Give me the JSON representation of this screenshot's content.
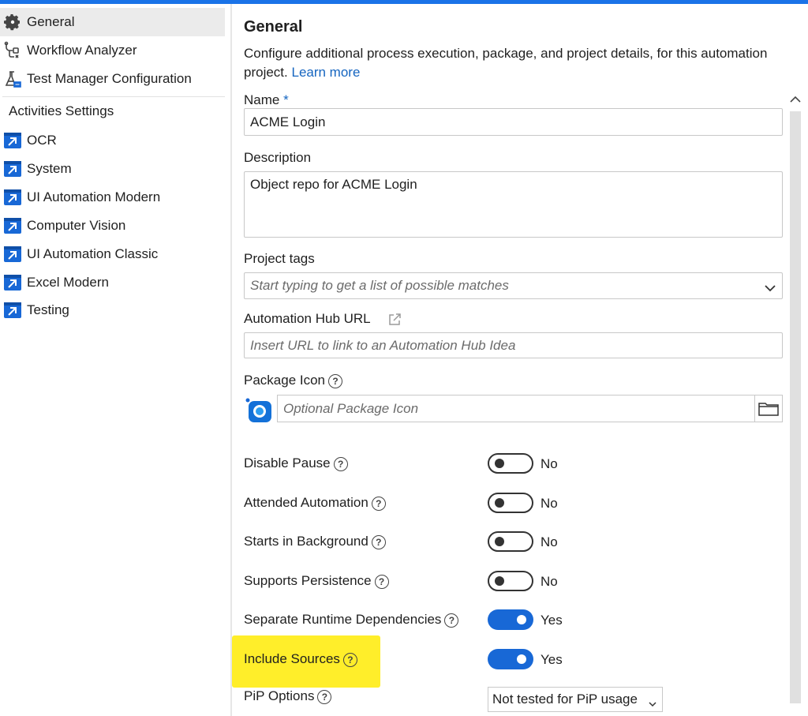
{
  "sidebar": {
    "items": [
      {
        "label": "General",
        "icon": "gear-icon",
        "selected": true
      },
      {
        "label": "Workflow Analyzer",
        "icon": "workflow-analyzer-icon"
      },
      {
        "label": "Test Manager Configuration",
        "icon": "test-manager-icon"
      }
    ],
    "section_heading": "Activities Settings",
    "activities": [
      "OCR",
      "System",
      "UI Automation Modern",
      "Computer Vision",
      "UI Automation Classic",
      "Excel Modern",
      "Testing"
    ]
  },
  "main": {
    "title": "General",
    "description": "Configure additional process execution, package, and project details, for this automation project.",
    "learn_more": "Learn more",
    "name_label": "Name",
    "name_required": "*",
    "name_value": "ACME Login",
    "description_label": "Description",
    "description_value": "Object repo for ACME Login",
    "tags_label": "Project tags",
    "tags_placeholder": "Start typing to get a list of possible matches",
    "hub_label": "Automation Hub URL",
    "hub_placeholder": "Insert URL to link to an Automation Hub Idea",
    "icon_label": "Package Icon",
    "icon_placeholder": "Optional Package Icon",
    "help_glyph": "?",
    "toggles": [
      {
        "label": "Disable Pause",
        "state": "No",
        "on": false
      },
      {
        "label": "Attended Automation",
        "state": "No",
        "on": false
      },
      {
        "label": "Starts in Background",
        "state": "No",
        "on": false
      },
      {
        "label": "Supports Persistence",
        "state": "No",
        "on": false
      },
      {
        "label": "Separate Runtime Dependencies",
        "state": "Yes",
        "on": true
      },
      {
        "label": "Include Sources",
        "state": "Yes",
        "on": true
      }
    ],
    "pip_label": "PiP Options",
    "pip_value": "Not tested for PiP usage"
  },
  "colors": {
    "accent": "#1868d6",
    "highlight": "#ffee2a",
    "link": "#1565c0"
  }
}
